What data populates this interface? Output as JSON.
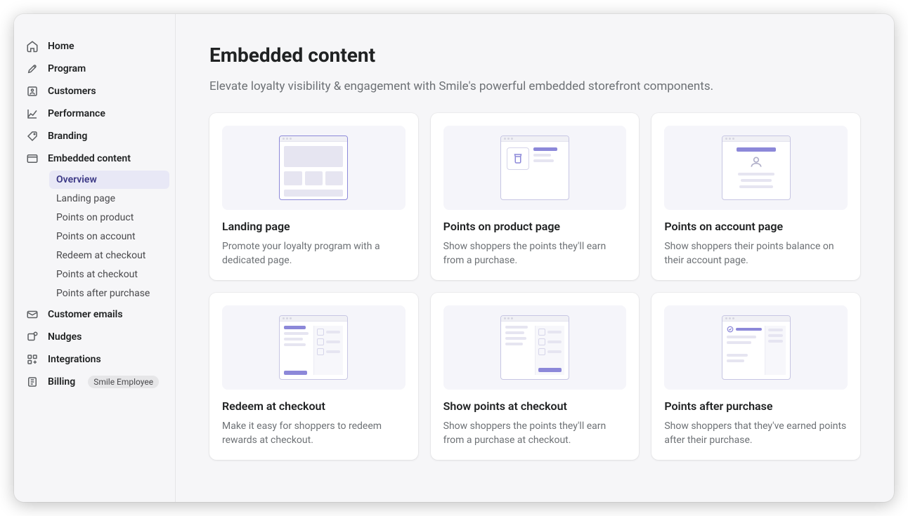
{
  "sidebar": {
    "items": [
      {
        "key": "home",
        "label": "Home"
      },
      {
        "key": "program",
        "label": "Program"
      },
      {
        "key": "customers",
        "label": "Customers"
      },
      {
        "key": "performance",
        "label": "Performance"
      },
      {
        "key": "branding",
        "label": "Branding"
      },
      {
        "key": "embedded",
        "label": "Embedded content"
      },
      {
        "key": "emails",
        "label": "Customer emails"
      },
      {
        "key": "nudges",
        "label": "Nudges"
      },
      {
        "key": "integrations",
        "label": "Integrations"
      },
      {
        "key": "billing",
        "label": "Billing"
      }
    ],
    "embedded_sub": [
      {
        "key": "overview",
        "label": "Overview",
        "active": true
      },
      {
        "key": "landing",
        "label": "Landing page"
      },
      {
        "key": "points-product",
        "label": "Points on product"
      },
      {
        "key": "points-account",
        "label": "Points on account"
      },
      {
        "key": "redeem-checkout",
        "label": "Redeem at checkout"
      },
      {
        "key": "points-checkout",
        "label": "Points at checkout"
      },
      {
        "key": "points-after",
        "label": "Points after purchase"
      }
    ],
    "billing_badge": "Smile Employee"
  },
  "page": {
    "title": "Embedded content",
    "subtitle": "Elevate loyalty visibility & engagement with Smile's powerful embedded storefront components."
  },
  "cards": [
    {
      "key": "landing",
      "title": "Landing page",
      "desc": "Promote your loyalty program with a dedicated page."
    },
    {
      "key": "product",
      "title": "Points on product page",
      "desc": "Show shoppers the points they'll earn from a purchase."
    },
    {
      "key": "account",
      "title": "Points on account page",
      "desc": "Show shoppers their points balance on their account page."
    },
    {
      "key": "redeem",
      "title": "Redeem at checkout",
      "desc": "Make it easy for shoppers to redeem rewards at checkout."
    },
    {
      "key": "show-checkout",
      "title": "Show points at checkout",
      "desc": "Show shoppers the points they'll earn from a purchase at checkout."
    },
    {
      "key": "after",
      "title": "Points after purchase",
      "desc": "Show shoppers that they've earned points after their purchase."
    }
  ]
}
